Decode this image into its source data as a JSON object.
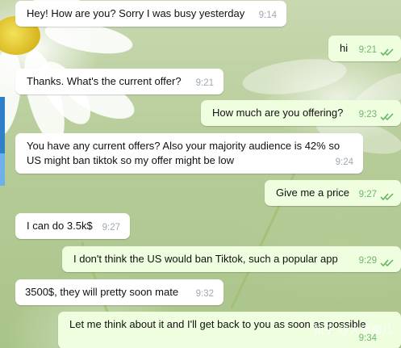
{
  "chat": {
    "messages": [
      {
        "dir": "in",
        "text": "Hey! How are you? Sorry I was busy yesterday",
        "time": "9:14"
      },
      {
        "dir": "out",
        "text": "hi",
        "time": "9:21"
      },
      {
        "dir": "in",
        "text": "Thanks. What's the current offer?",
        "time": "9:21"
      },
      {
        "dir": "out",
        "text": "How much are you offering?",
        "time": "9:23"
      },
      {
        "dir": "in",
        "text": "You have any current offers? Also your majority audience is 42% so US might ban tiktok so my offer might be low",
        "time": "9:24"
      },
      {
        "dir": "out",
        "text": "Give me a price",
        "time": "9:27"
      },
      {
        "dir": "in",
        "text": "I can do 3.5k$",
        "time": "9:27"
      },
      {
        "dir": "out",
        "text": "I don't think the US would ban Tiktok, such a popular app",
        "time": "9:29"
      },
      {
        "dir": "in",
        "text": "3500$, they will pretty soon mate",
        "time": "9:32"
      },
      {
        "dir": "out",
        "text": "Let me think about it and I'll get back to you as soon as possible",
        "time": "9:34"
      }
    ]
  },
  "watermark": "知乎 @大硕福儿",
  "colors": {
    "incoming_bubble": "#ffffff",
    "outgoing_bubble": "#eefedf",
    "outgoing_time": "#6fb770",
    "incoming_time": "#a0a9b3",
    "read_ticks": "#5fb35f"
  },
  "icons": {
    "read_receipt": "double-check-icon"
  }
}
